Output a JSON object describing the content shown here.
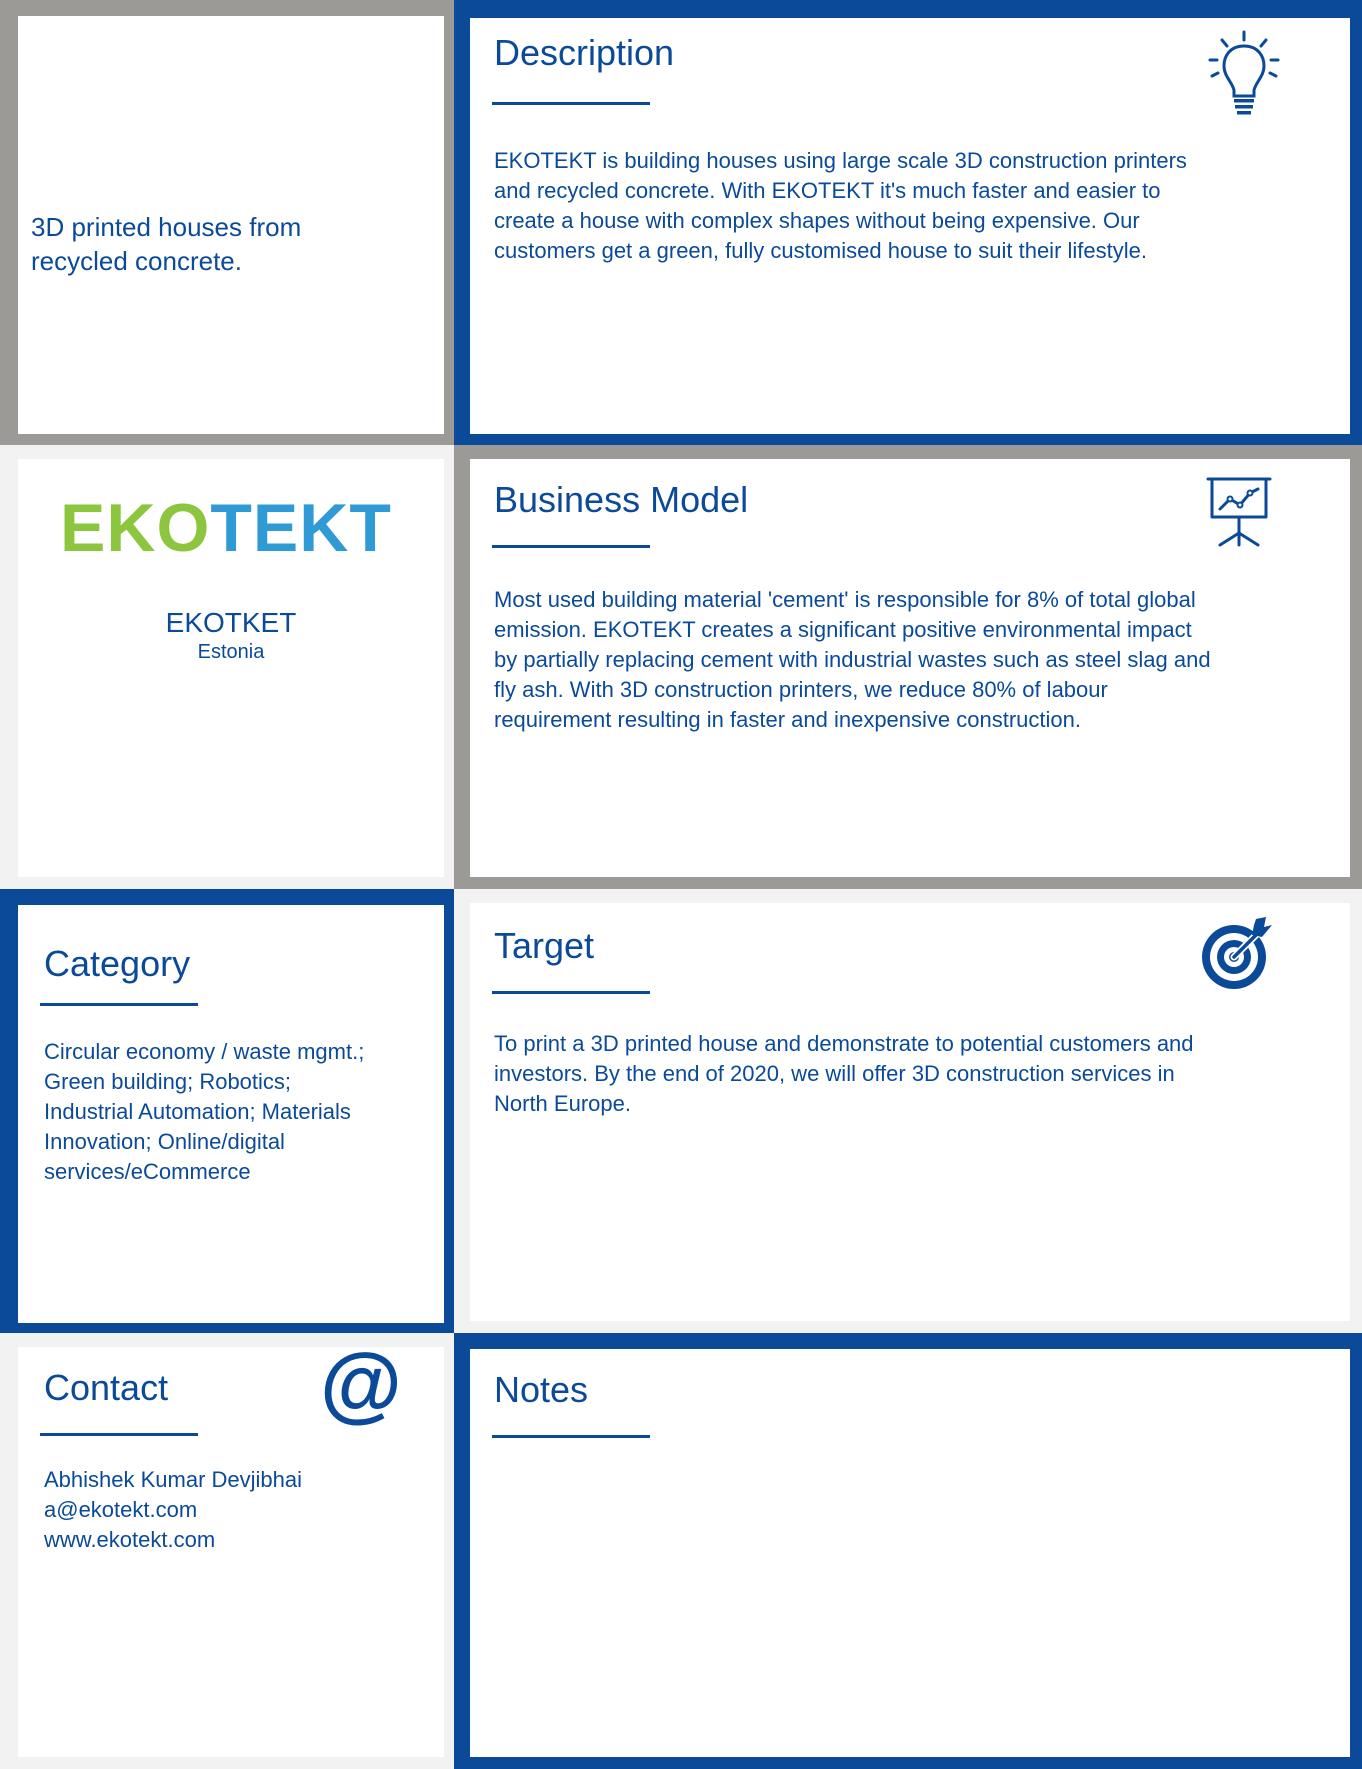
{
  "tagline": {
    "line1": "3D printed houses from",
    "line2": "recycled concrete."
  },
  "logo": {
    "part1": "EKO",
    "part2": "TEKT"
  },
  "company": {
    "name": "EKOTKET",
    "country": "Estonia"
  },
  "description": {
    "title": "Description",
    "lines": [
      "EKOTEKT is building houses using large scale 3D construction printers",
      "and recycled concrete. With EKOTEKT it's much faster and easier to",
      "create a house with complex shapes without being expensive. Our",
      "customers get a green, fully customised house to suit their lifestyle."
    ]
  },
  "business_model": {
    "title": "Business Model",
    "lines": [
      "Most used building material 'cement' is responsible for 8% of total global",
      "emission. EKOTEKT creates a significant positive environmental impact",
      "by partially replacing cement with industrial wastes such as steel slag and",
      "fly ash. With 3D construction printers, we reduce 80% of labour",
      "requirement resulting in faster and inexpensive construction."
    ]
  },
  "category": {
    "title": "Category",
    "lines": [
      "Circular economy / waste mgmt.;",
      "Green building; Robotics;",
      "Industrial Automation; Materials",
      "Innovation; Online/digital",
      "services/eCommerce"
    ]
  },
  "target": {
    "title": "Target",
    "lines": [
      "To print a 3D printed house and demonstrate to potential customers and",
      "investors. By the end of 2020, we will offer 3D construction services in",
      "North Europe."
    ]
  },
  "contact": {
    "title": "Contact",
    "lines": [
      "Abhishek Kumar Devjibhai",
      "a@ekotekt.com",
      "www.ekotekt.com"
    ]
  },
  "notes": {
    "title": "Notes"
  },
  "icons": {
    "description": "lightbulb-icon",
    "business_model": "presentation-chart-icon",
    "target": "target-icon",
    "contact": "at-sign-icon"
  },
  "colors": {
    "primary_blue": "#0b4a99",
    "frame_gray": "#9b9a97",
    "light_gray": "#f2f2f2",
    "logo_green": "#8cc63f",
    "logo_blue": "#2f9ad4"
  }
}
